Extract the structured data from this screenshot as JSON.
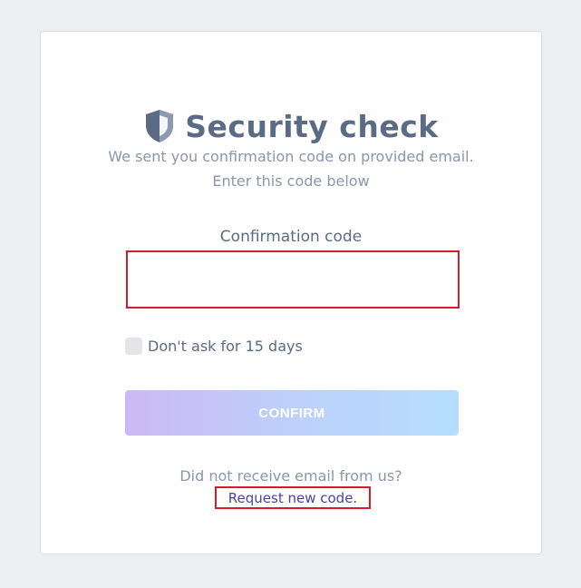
{
  "page": {
    "title": "Security check",
    "subtitle_line1": "We sent you confirmation code on provided email.",
    "subtitle_line2": "Enter this code below"
  },
  "form": {
    "code_label": "Confirmation code",
    "code_value": "",
    "remember_label": "Don't ask for 15 days",
    "remember_checked": false,
    "confirm_label": "CONFIRM",
    "confirm_enabled": false
  },
  "footer": {
    "no_email_text": "Did not receive email from us?",
    "request_link_label": "Request new code."
  },
  "icons": {
    "title_icon": "shield-icon"
  },
  "colors": {
    "accent_link": "#4a3fb3",
    "title": "#5b6b86",
    "highlight_border": "#d11e2a",
    "button_gradient_start": "#ccb8f6",
    "button_gradient_end": "#b6ddfe"
  }
}
